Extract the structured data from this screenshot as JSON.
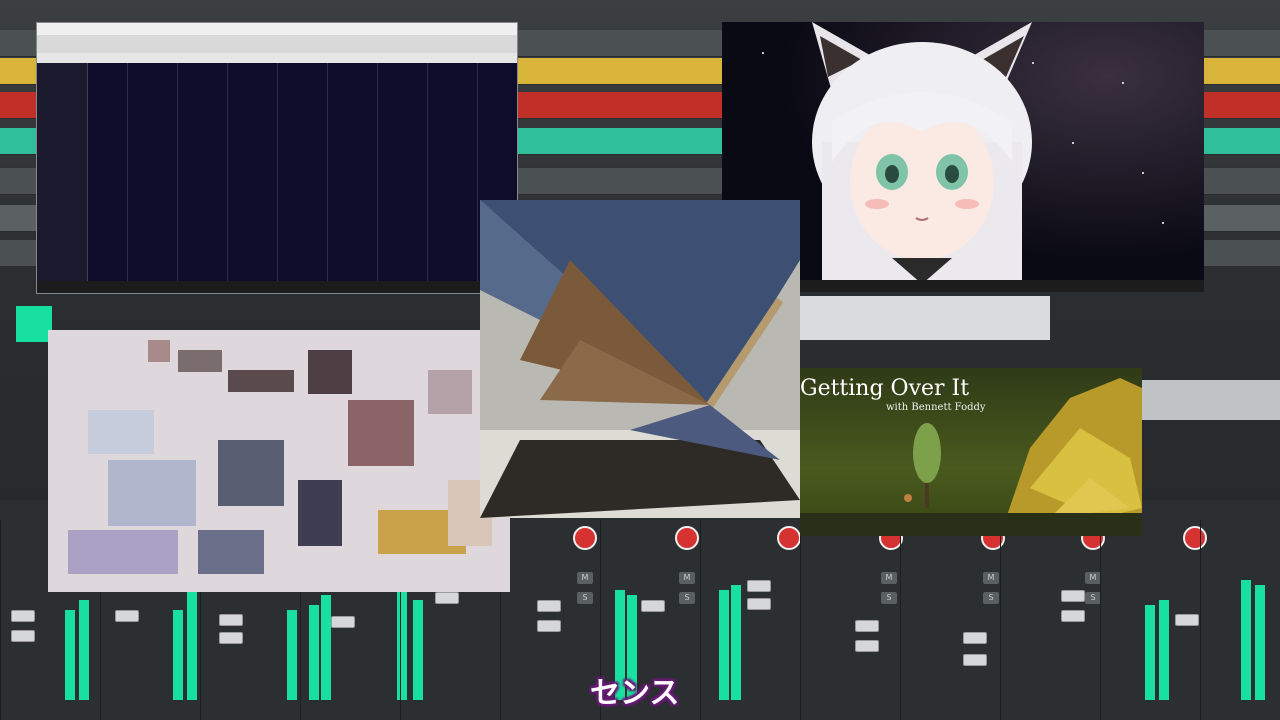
{
  "subtitle": "センス",
  "game": {
    "title": "Getting Over It",
    "subtitle": "with Bennett Foddy"
  },
  "colors": {
    "meter_green": "#18e0a0",
    "track_yellow": "#d8b43a",
    "track_red": "#c03028",
    "track_teal": "#2fbf9a",
    "subtitle_outline": "#6a1a7a"
  },
  "icons": [
    "record-button-icon",
    "speaker-icon",
    "fader-icon"
  ]
}
